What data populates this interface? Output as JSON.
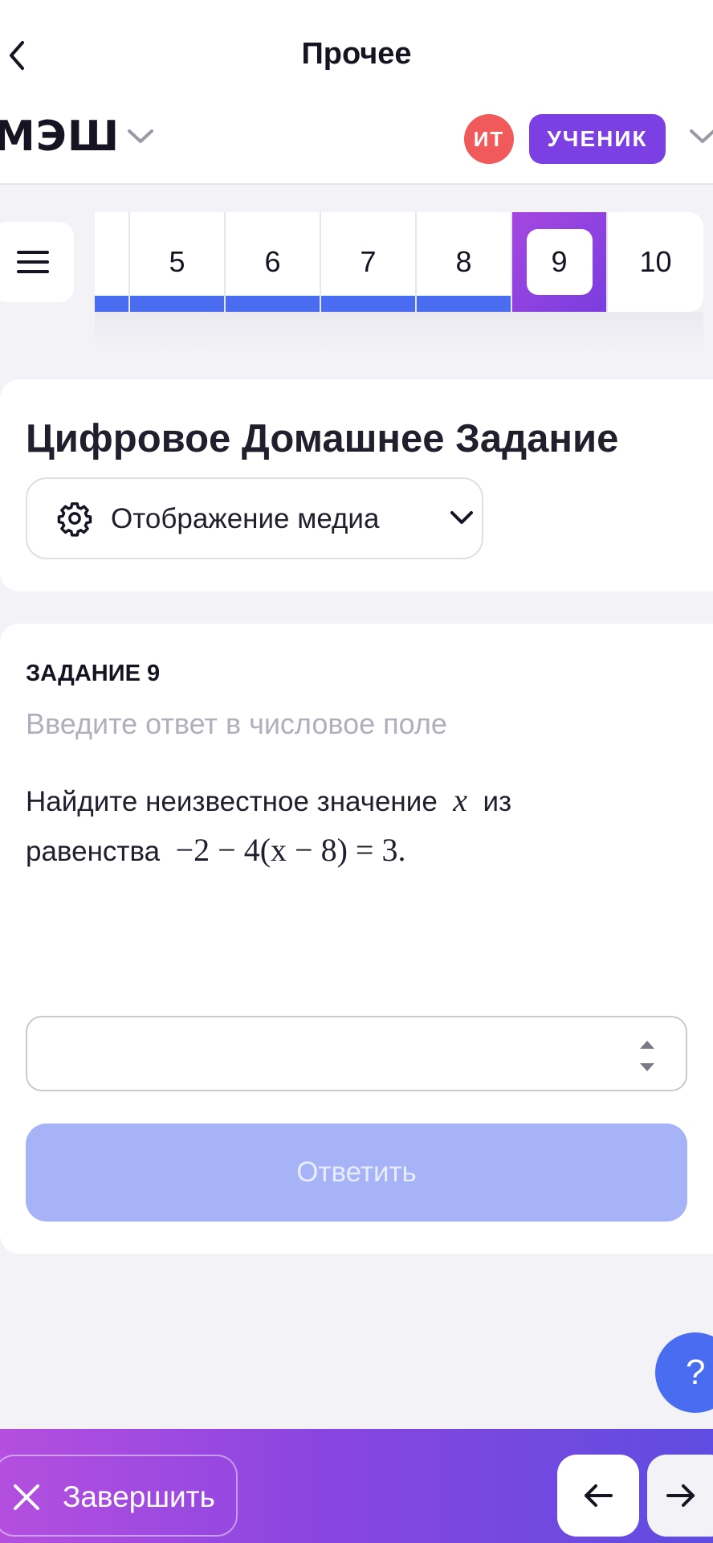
{
  "header": {
    "title": "Прочее",
    "brand": "МЭШ",
    "avatar_initials": "ИТ",
    "role_label": "УЧЕНИК"
  },
  "task_nav": {
    "items": [
      "5",
      "6",
      "7",
      "8",
      "9",
      "10"
    ],
    "active": "9",
    "accent_color": "#4a6cf0"
  },
  "main": {
    "title": "Цифровое Домашнее Задание",
    "media_toggle_label": "Отображение медиа"
  },
  "task": {
    "label": "ЗАДАНИЕ 9",
    "hint": "Введите ответ в числовое поле",
    "question_part1": "Найдите неизвестное значение",
    "variable": "x",
    "question_part2": "из",
    "question_part3": "равенства",
    "equation": "−2 − 4(x − 8) = 3.",
    "answer_value": "",
    "submit_label": "Ответить"
  },
  "help": {
    "label": "?"
  },
  "footer": {
    "finish_label": "Завершить",
    "prev_icon": "arrow-left-icon",
    "next_icon": "arrow-right-icon"
  }
}
